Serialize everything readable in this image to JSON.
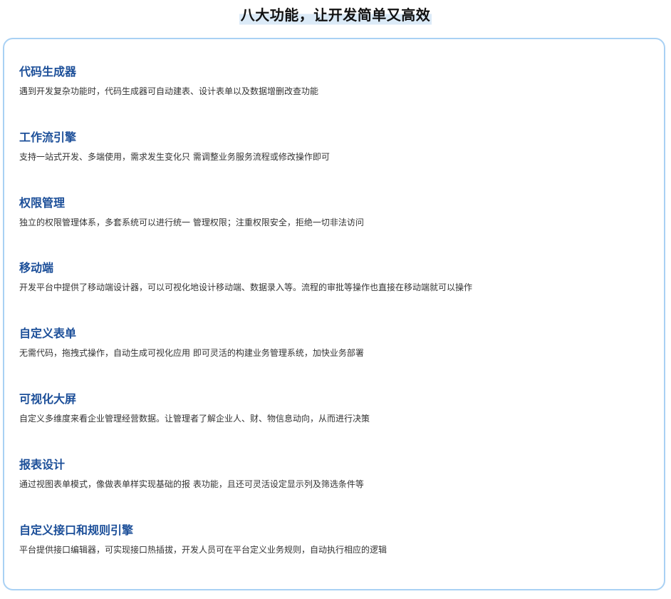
{
  "page": {
    "title": "八大功能，让开发简单又高效"
  },
  "features": [
    {
      "title": "代码生成器",
      "description": "遇到开发复杂功能时，代码生成器可自动建表、设计表单以及数据增删改查功能"
    },
    {
      "title": "工作流引擎",
      "description": "支持一站式开发、多端使用，需求发生变化只 需调整业务服务流程或修改操作即可"
    },
    {
      "title": "权限管理",
      "description": "独立的权限管理体系，多套系统可以进行统一 管理权限；注重权限安全，拒绝一切非法访问"
    },
    {
      "title": "移动端",
      "description": "开发平台中提供了移动端设计器，可以可视化地设计移动端、数据录入等。流程的审批等操作也直接在移动端就可以操作"
    },
    {
      "title": "自定义表单",
      "description": "无需代码，拖拽式操作，自动生成可视化应用 即可灵活的构建业务管理系统，加快业务部署"
    },
    {
      "title": "可视化大屏",
      "description": "自定义多维度来看企业管理经营数据。让管理者了解企业人、财、物信息动向，从而进行决策"
    },
    {
      "title": "报表设计",
      "description": "通过视图表单模式，像做表单样实现基础的报 表功能，且还可灵活设定显示列及筛选条件等"
    },
    {
      "title": "自定义接口和规则引擎",
      "description": "平台提供接口编辑器，可实现接口热插拔，开发人员可在平台定义业务规则，自动执行相应的逻辑"
    }
  ]
}
